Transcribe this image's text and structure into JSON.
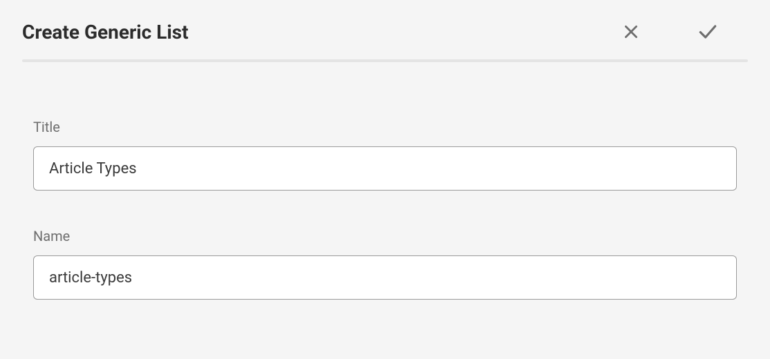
{
  "header": {
    "title": "Create Generic List"
  },
  "form": {
    "title": {
      "label": "Title",
      "value": "Article Types"
    },
    "name": {
      "label": "Name",
      "value": "article-types"
    }
  }
}
